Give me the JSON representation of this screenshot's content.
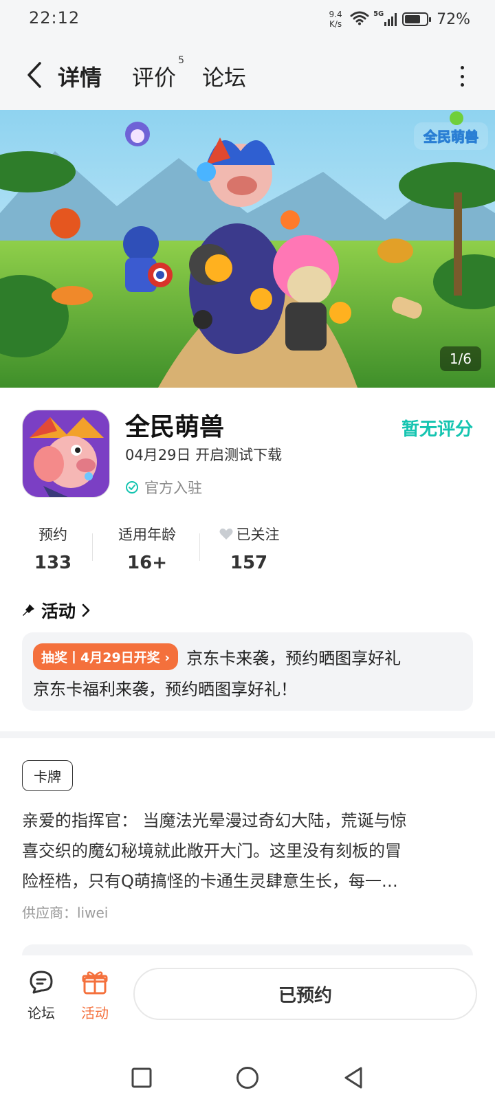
{
  "status_bar": {
    "time": "22:12",
    "net_speed_value": "9.4",
    "net_speed_unit": "K/s",
    "signal_label": "5G",
    "battery_percent": "72%",
    "battery_level": 0.72
  },
  "header": {
    "tabs": [
      {
        "label": "详情",
        "active": true
      },
      {
        "label": "评价",
        "badge": "5"
      },
      {
        "label": "论坛"
      }
    ]
  },
  "banner": {
    "logo_text": "全民萌兽",
    "page_indicator": "1/6"
  },
  "app": {
    "name": "全民萌兽",
    "date_text": "04月29日 开启测试下载",
    "official_text": "官方入驻",
    "rating_text": "暂无评分"
  },
  "stats": [
    {
      "label": "预约",
      "value": "133"
    },
    {
      "label": "适用年龄",
      "value": "16+"
    },
    {
      "label": "已关注",
      "value": "157"
    }
  ],
  "activity": {
    "title": "活动",
    "badge": "抽奖丨4月29日开奖",
    "headline": "京东卡来袭，预约晒图享好礼",
    "detail": "京东卡福利来袭，预约晒图享好礼！"
  },
  "description": {
    "tag": "卡牌",
    "text_line1": "亲爱的指挥官： 当魔法光晕漫过奇幻大陆，荒诞与惊",
    "text_line2": "喜交织的魔幻秘境就此敞开大门。这里没有刻板的冒",
    "text_line3": "险桎梏，只有Q萌搞怪的卡通生灵肆意生长，每一…",
    "supplier": "供应商：liwei"
  },
  "bottom_bar": {
    "forum_label": "论坛",
    "activity_label": "活动",
    "reserve_label": "已预约",
    "accent_color": "#f4703c"
  },
  "colors": {
    "teal": "#14c4b0",
    "tab_underline": "#2dd4bf",
    "orange": "#f4703c"
  }
}
